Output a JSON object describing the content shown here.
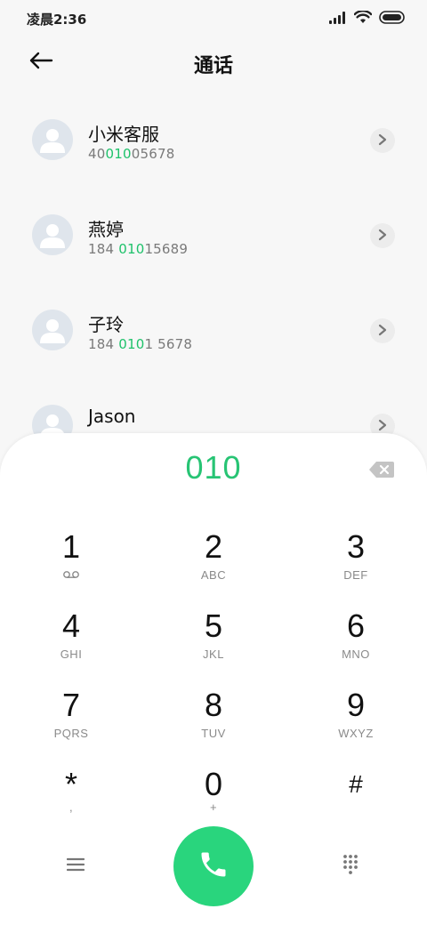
{
  "status_bar": {
    "time": "凌晨2:36",
    "icons": [
      "signal-icon",
      "wifi-icon",
      "battery-icon"
    ]
  },
  "header": {
    "title": "通话",
    "back_icon": "back-arrow-icon"
  },
  "contacts": [
    {
      "name": "小米客服",
      "number_parts": [
        "40",
        "010",
        "05678"
      ]
    },
    {
      "name": "燕婷",
      "number_parts": [
        "184 ",
        "010",
        "15689"
      ]
    },
    {
      "name": "子玲",
      "number_parts": [
        "184 ",
        "010",
        "1 5678"
      ]
    },
    {
      "name": "Jason",
      "number_parts": [
        "",
        "",
        ""
      ]
    }
  ],
  "dialer": {
    "input_value": "010",
    "delete_icon": "backspace-icon",
    "keys": [
      {
        "digit": "1",
        "letters": "voicemail-icon"
      },
      {
        "digit": "2",
        "letters": "ABC"
      },
      {
        "digit": "3",
        "letters": "DEF"
      },
      {
        "digit": "4",
        "letters": "GHI"
      },
      {
        "digit": "5",
        "letters": "JKL"
      },
      {
        "digit": "6",
        "letters": "MNO"
      },
      {
        "digit": "7",
        "letters": "PQRS"
      },
      {
        "digit": "8",
        "letters": "TUV"
      },
      {
        "digit": "9",
        "letters": "WXYZ"
      },
      {
        "digit": "*",
        "letters": ","
      },
      {
        "digit": "0",
        "letters": "+"
      },
      {
        "digit": "#",
        "letters": ""
      }
    ]
  },
  "bottom_bar": {
    "menu_icon": "menu-icon",
    "call_icon": "phone-icon",
    "keypad_icon": "dialpad-icon"
  },
  "colors": {
    "accent_green": "#27c474",
    "call_button": "#29d57d",
    "background": "#f7f7f7",
    "avatar_bg": "#dfe5ec"
  }
}
